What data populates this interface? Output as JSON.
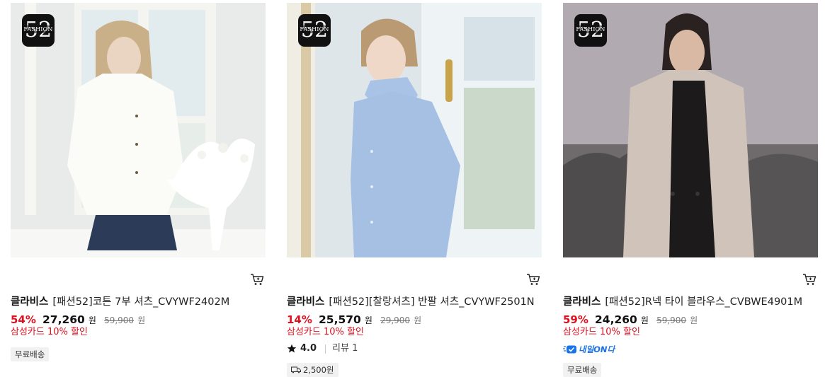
{
  "products": [
    {
      "brand": "클라비스",
      "name": "[패션52]코튼 7부 셔츠_CVYWF2402M",
      "discount": "54%",
      "price": "27,260",
      "price_unit": "원",
      "original_price": "59,900",
      "original_unit": "원",
      "card_promo": "삼성카드 10% 할인",
      "tags": [
        "무료배송"
      ]
    },
    {
      "brand": "클라비스",
      "name": "[패션52][찰랑셔츠] 반팔 셔츠_CVYWF2501N",
      "discount": "14%",
      "price": "25,570",
      "price_unit": "원",
      "original_price": "29,900",
      "original_unit": "원",
      "card_promo": "삼성카드 10% 할인",
      "rating": "4.0",
      "review_label": "리뷰 1",
      "shipping_fee": "2,500원"
    },
    {
      "brand": "클라비스",
      "name": "[패션52]R넥 타이 블라우스_CVBWE4901M",
      "discount": "59%",
      "price": "24,260",
      "price_unit": "원",
      "original_price": "59,900",
      "original_unit": "원",
      "card_promo": "삼성카드 10% 할인",
      "delivery_badge": "내일ON다",
      "tags": [
        "무료배송"
      ]
    }
  ],
  "badge_logo": {
    "number": "52",
    "word": "FASHION"
  },
  "icons": {
    "cart": "cart-icon",
    "star": "star-icon",
    "truck": "truck-icon",
    "nextday": "nextday-delivery-icon"
  },
  "colors": {
    "discount": "#e0101e",
    "promo": "#e0101e",
    "nextday": "#1a73e8",
    "tag_bg": "#f1f1f1"
  }
}
